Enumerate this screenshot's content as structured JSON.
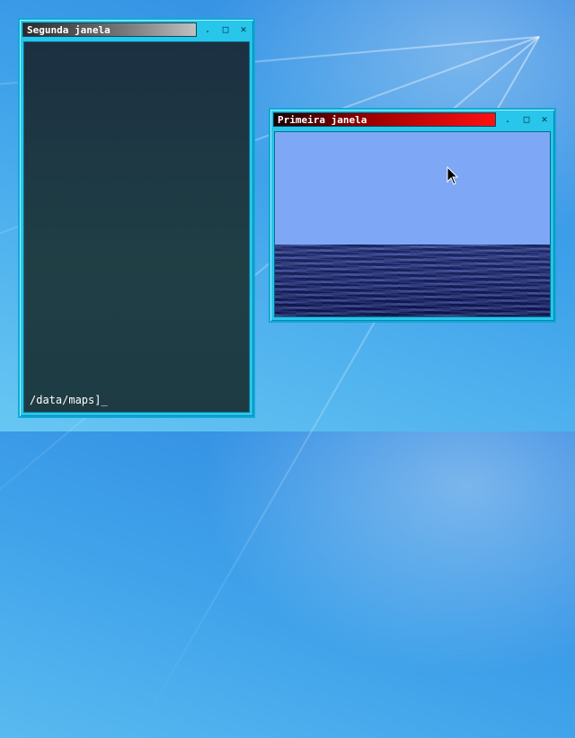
{
  "desktop": {
    "background_color": "#3fa2ea"
  },
  "windows": [
    {
      "title": "Segunda janela",
      "controls": {
        "minimize": ".",
        "maximize": "□",
        "close": "✕"
      },
      "terminal": {
        "prompt_line": "/data/maps]_"
      }
    },
    {
      "title": "Primeira janela",
      "controls": {
        "minimize": ".",
        "maximize": "□",
        "close": "✕"
      }
    }
  ],
  "colors": {
    "frame": "#27c6ea",
    "sky": "#7ea8f6",
    "sea": "#26306a",
    "title_active": "#ff1010",
    "title_inactive": "#7a7a7a"
  }
}
